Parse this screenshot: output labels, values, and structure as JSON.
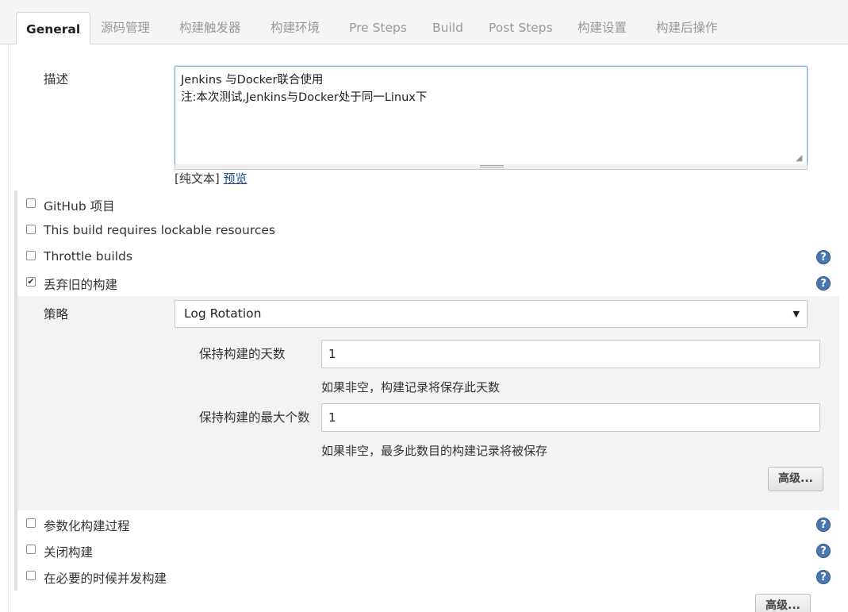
{
  "tabs": [
    "General",
    "源码管理",
    "构建触发器",
    "构建环境",
    "Pre Steps",
    "Build",
    "Post Steps",
    "构建设置",
    "构建后操作"
  ],
  "description": {
    "label": "描述",
    "value": "Jenkins 与Docker联合使用\n注:本次测试,Jenkins与Docker处于同一Linux下",
    "plain_text_label": "[纯文本]",
    "preview_link": "预览"
  },
  "options": {
    "github_project": {
      "label": "GitHub 项目",
      "checked": false
    },
    "lockable_resources": {
      "label": "This build requires lockable resources",
      "checked": false
    },
    "throttle_builds": {
      "label": "Throttle builds",
      "checked": false
    },
    "discard_old_builds": {
      "label": "丢弃旧的构建",
      "checked": true,
      "check_mark": "✔"
    },
    "parameterized": {
      "label": "参数化构建过程",
      "checked": false
    },
    "disable_build": {
      "label": "关闭构建",
      "checked": false
    },
    "concurrent_builds": {
      "label": "在必要的时候并发构建",
      "checked": false
    }
  },
  "strategy": {
    "label": "策略",
    "selected": "Log Rotation",
    "arrow": "▼",
    "days_label": "保持构建的天数",
    "days_value": "1",
    "days_hint": "如果非空，构建记录将保存此天数",
    "max_label": "保持构建的最大个数",
    "max_value": "1",
    "max_hint": "如果非空，最多此数目的构建记录将被保存",
    "advanced_button": "高级..."
  },
  "bottom_advanced_button": "高级...",
  "help_glyph": "?",
  "colors": {
    "accent": "#4b76ae",
    "link": "#204a87"
  }
}
